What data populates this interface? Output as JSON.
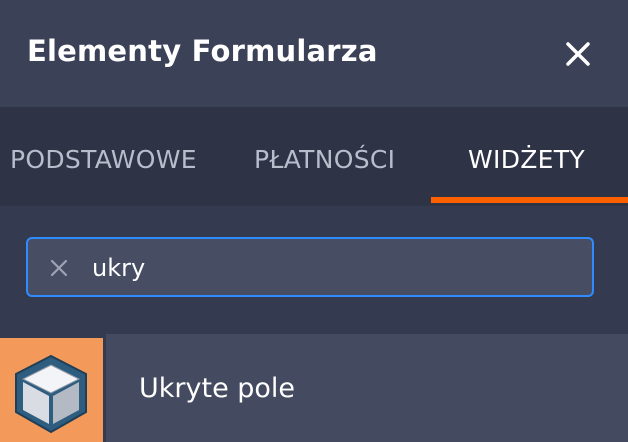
{
  "panel": {
    "title": "Elementy Formularza",
    "close_icon": "close-icon"
  },
  "tabs": [
    {
      "label": "PODSTAWOWE",
      "active": false
    },
    {
      "label": "PŁATNOŚCI",
      "active": false
    },
    {
      "label": "WIDŻETY",
      "active": true
    }
  ],
  "search": {
    "value": "ukry",
    "clear_icon": "clear-icon"
  },
  "results": [
    {
      "label": "Ukryte pole",
      "icon": "cube-icon"
    }
  ],
  "colors": {
    "accent": "#ff6100",
    "focus_border": "#2f8cff",
    "thumb_bg": "#f39a5a"
  }
}
